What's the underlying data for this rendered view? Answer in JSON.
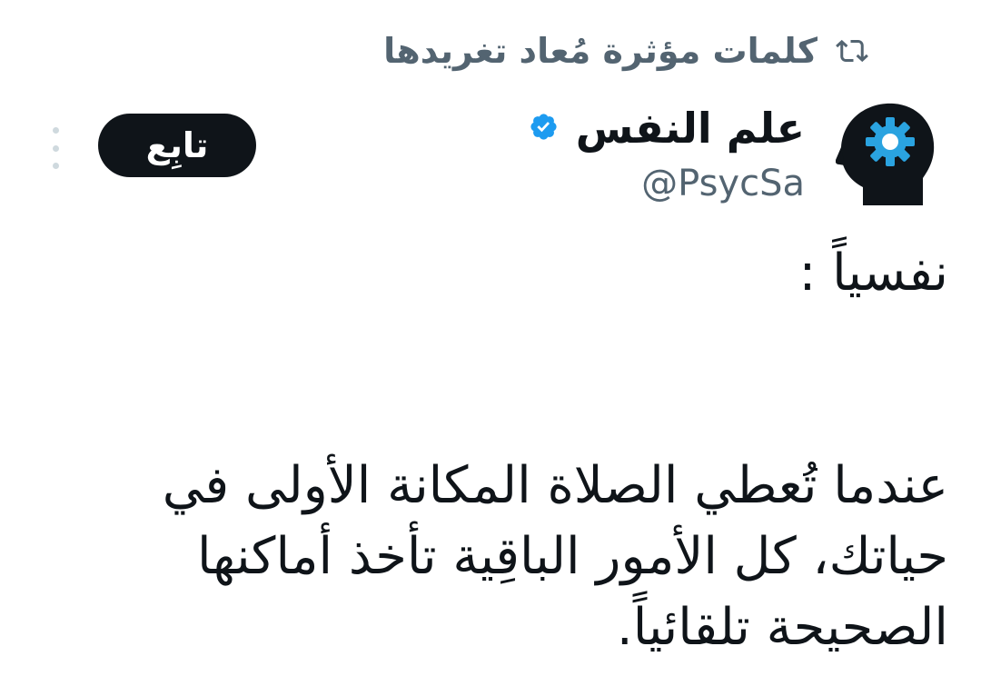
{
  "retweet": {
    "icon": "retweet-icon",
    "text": "كلمات مؤثرة مُعاد تغريدها"
  },
  "author": {
    "avatar_icon": "head-gear-avatar",
    "name": "علم النفس",
    "verified_icon": "verified-badge-icon",
    "handle": "@PsycSa"
  },
  "actions": {
    "follow_label": "تابِع",
    "more_icon": "more-vertical-icon"
  },
  "tweet": {
    "line1": "نفسياً :",
    "paragraph": "عندما تُعطي الصلاة المكانة الأولى في حياتك، كل الأمور الباقِية تأخذ أماكنها الصحيحة تلقائياً."
  },
  "colors": {
    "text": "#0f1419",
    "secondary": "#536471",
    "verified": "#1d9bf0",
    "follow_bg": "#0f1419",
    "follow_text": "#ffffff",
    "avatar_gear": "#2aa3e0"
  }
}
